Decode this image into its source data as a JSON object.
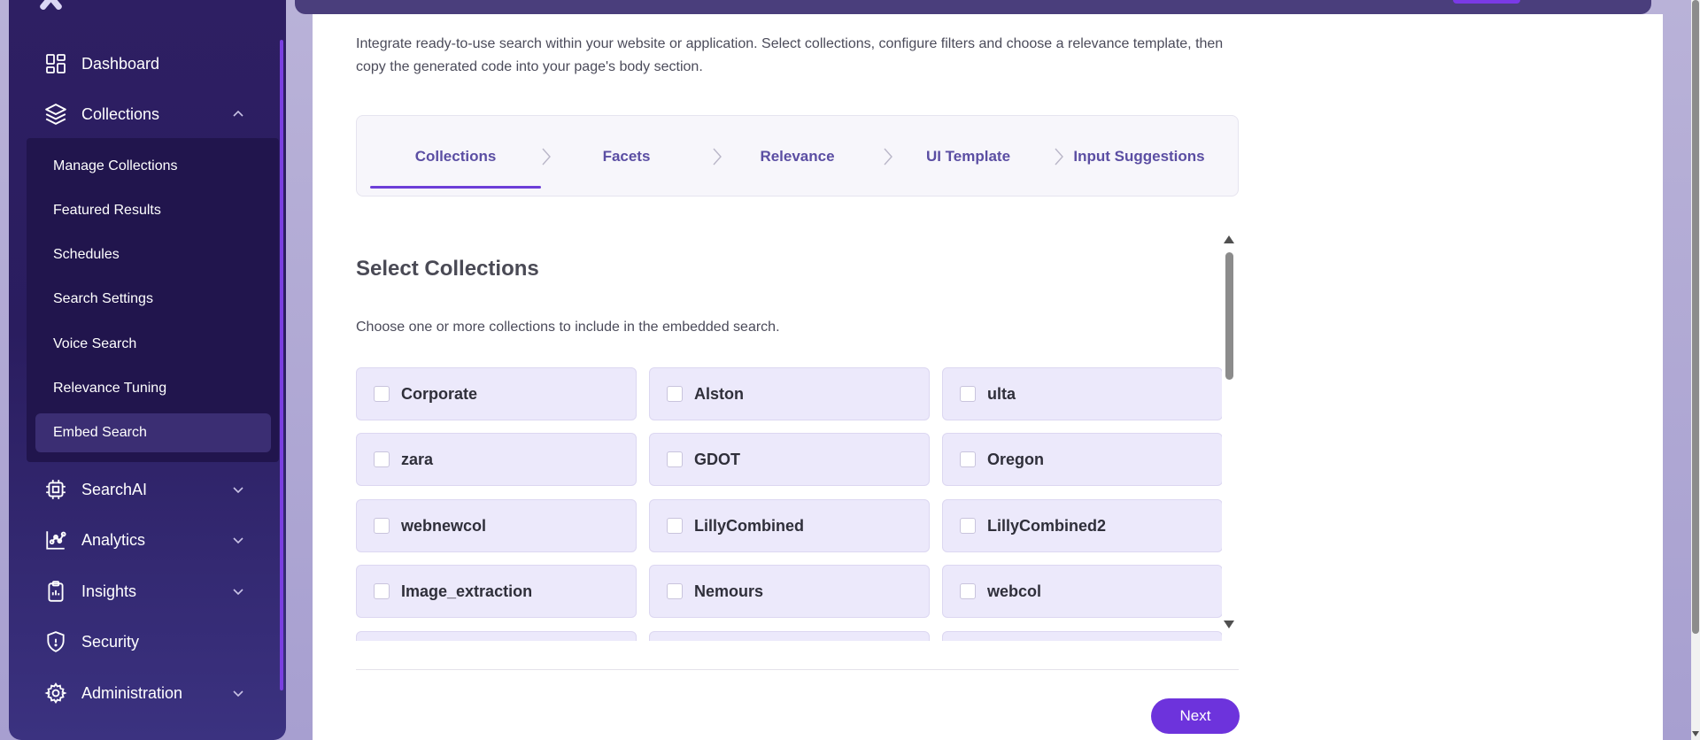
{
  "sidebar": {
    "nav": [
      {
        "label": "Dashboard",
        "icon": "dashboard-icon"
      },
      {
        "label": "Collections",
        "icon": "layers-icon",
        "expanded": true
      },
      {
        "label": "SearchAI",
        "icon": "chip-icon"
      },
      {
        "label": "Analytics",
        "icon": "analytics-icon"
      },
      {
        "label": "Insights",
        "icon": "clipboard-icon"
      },
      {
        "label": "Security",
        "icon": "shield-icon"
      },
      {
        "label": "Administration",
        "icon": "gear-icon"
      }
    ],
    "collections_sub": [
      {
        "label": "Manage Collections"
      },
      {
        "label": "Featured Results"
      },
      {
        "label": "Schedules"
      },
      {
        "label": "Search Settings"
      },
      {
        "label": "Voice Search"
      },
      {
        "label": "Relevance Tuning"
      },
      {
        "label": "Embed Search",
        "active": true
      }
    ]
  },
  "main": {
    "description": "Integrate ready-to-use search within your website or application. Select collections, configure filters and choose a relevance template, then copy the generated code into your page's body section.",
    "steps": [
      {
        "label": "Collections",
        "active": true
      },
      {
        "label": "Facets"
      },
      {
        "label": "Relevance"
      },
      {
        "label": "UI Template"
      },
      {
        "label": "Input Suggestions"
      }
    ],
    "section_title": "Select Collections",
    "section_desc": "Choose one or more collections to include in the embedded search.",
    "collections": [
      "Corporate",
      "Alston",
      "ulta",
      "zara",
      "GDOT",
      "Oregon",
      "webnewcol",
      "LillyCombined",
      "LillyCombined2",
      "Image_extraction",
      "Nemours",
      "webcol"
    ],
    "next_label": "Next"
  },
  "colors": {
    "accent": "#6d33dc",
    "sidebar_bg": "#2e1f63",
    "card_bg": "#ece9fb"
  }
}
